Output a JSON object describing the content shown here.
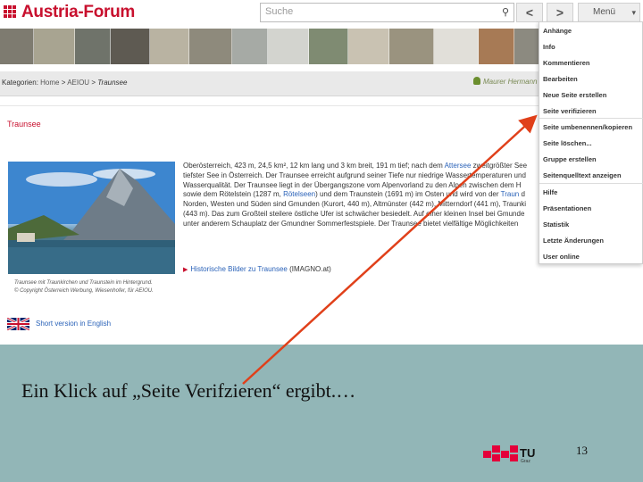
{
  "header": {
    "logo_text": "Austria-Forum",
    "search_placeholder": "Suche",
    "prev_label": "<",
    "next_label": ">",
    "menu_label": "Menü"
  },
  "breadcrumb": {
    "prefix": "Kategorien:",
    "home": "Home",
    "sep1": ">",
    "aeiou": "AEIOU",
    "sep2": ">",
    "current": "Traunsee",
    "author": "Maurer Hermann"
  },
  "article": {
    "title": "Traunsee",
    "body_lines": [
      [
        "Oberösterreich, 423 m, 24,5 km², 12 km lang und 3 km breit, 191 m tief; nach dem ",
        "Attersee",
        " zweitgrößter See"
      ],
      [
        "tiefster See in Österreich. Der Traunsee erreicht aufgrund seiner Tiefe nur niedrige Wassertemperaturen und"
      ],
      [
        "Wasserqualität. Der Traunsee liegt in der Übergangszone vom Alpenvorland zu den Alpen zwischen dem H"
      ],
      [
        "sowie dem Rötelstein (1287 m, ",
        "Rötelseen",
        ") und dem Traunstein (1691 m) im Osten und wird von der ",
        "Traun",
        " d"
      ],
      [
        "Norden, Westen und Süden sind Gmunden (Kurort, 440 m), Altmünster (442 m), Mitterndorf (441 m), Traunki"
      ],
      [
        "(443 m). Das zum Großteil steilere östliche Ufer ist schwächer besiedelt. Auf einer kleinen Insel bei Gmunde"
      ],
      [
        "unter anderem Schauplatz der Gmundner Sommerfestspiele. Der Traunsee bietet vielfältige Möglichkeiten"
      ]
    ],
    "historical_link": "Historische Bilder zu Traunsee",
    "historical_source": "(IMAGNO.at)",
    "caption_line1": "Traunsee mit Traunkirchen und Traunstein im Hintergrund.",
    "caption_line2": "© Copyright Österreich Werbung, Wiesenhofer, für AEIOU.",
    "english_link": "Short version in English"
  },
  "menu_items": [
    "Anhänge",
    "Info",
    "Kommentieren",
    "Bearbeiten",
    "Neue Seite erstellen",
    "Seite verifizieren",
    "Seite umbenennen/kopieren",
    "Seite löschen...",
    "Gruppe erstellen",
    "Seitenquelltext anzeigen",
    "Hilfe",
    "Präsentationen",
    "Statistik",
    "Letzte Änderungen",
    "User online"
  ],
  "slide": {
    "caption": "Ein Klick auf „Seite Verifzieren“ ergibt.…",
    "page_number": "13",
    "logo_text": "TU",
    "logo_sub": "Graz"
  },
  "colors": {
    "brand_red": "#c8102e",
    "link_blue": "#2a62b8",
    "arrow_red": "#e0401a",
    "slide_bg": "#92b6b7"
  }
}
